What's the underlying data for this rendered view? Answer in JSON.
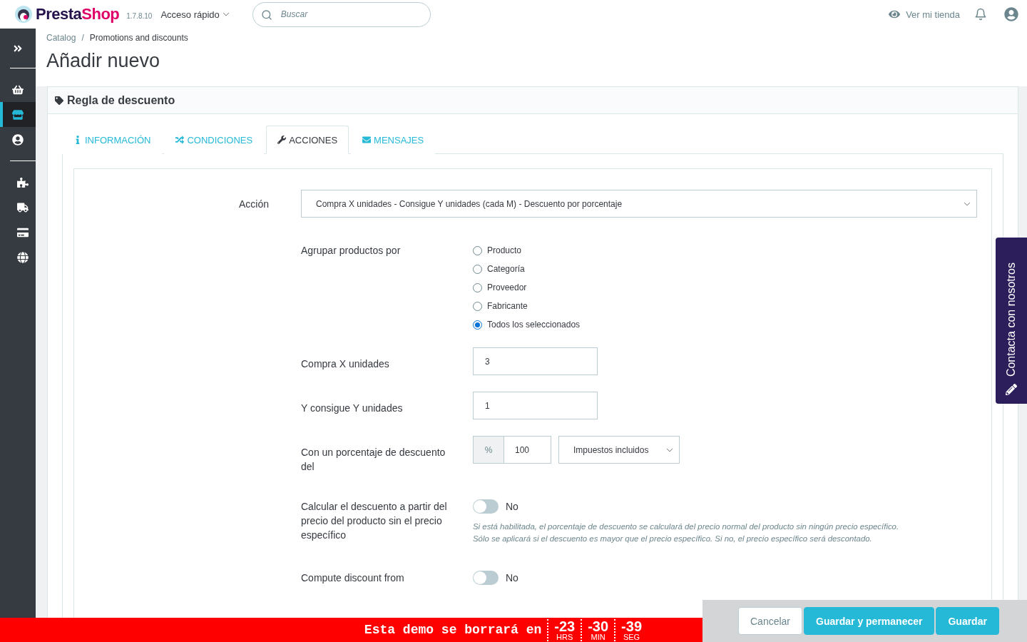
{
  "header": {
    "brand_left": "Presta",
    "brand_right": "Shop",
    "version": "1.7.8.10",
    "quick_access": "Acceso rápido",
    "search": {
      "placeholder": "Buscar"
    },
    "view_store": "Ver mi tienda"
  },
  "sidebar": {
    "groups": [
      [
        {
          "selected": false
        },
        {
          "selected": true
        },
        {
          "selected": false
        }
      ],
      [
        {
          "selected": false
        },
        {
          "selected": false
        },
        {
          "selected": false
        },
        {
          "selected": false
        }
      ]
    ]
  },
  "breadcrumb": {
    "separator": "/",
    "items": [
      "Catalog",
      "Promotions and discounts"
    ]
  },
  "page_title": "Añadir nuevo",
  "panel": {
    "title": "Regla de descuento",
    "tabs": [
      {
        "label": "INFORMACIÓN",
        "selected": false
      },
      {
        "label": "CONDICIONES",
        "selected": false
      },
      {
        "label": "ACCIONES",
        "selected": true
      },
      {
        "label": "MENSAJES",
        "selected": false
      }
    ],
    "action": {
      "label": "Acción",
      "value": "Compra X unidades - Consigue Y unidades (cada M) - Descuento por porcentaje"
    },
    "rows": [
      {
        "kind": "radios",
        "label": "Agrupar productos por",
        "options": [
          {
            "label": "Producto",
            "selected": false
          },
          {
            "label": "Categoría",
            "selected": false
          },
          {
            "label": "Proveedor",
            "selected": false
          },
          {
            "label": "Fabricante",
            "selected": false
          },
          {
            "label": "Todos los seleccionados",
            "selected": true
          }
        ]
      },
      {
        "kind": "input",
        "label": "Compra X unidades",
        "value": "3"
      },
      {
        "kind": "input",
        "label": "Y consigue Y unidades",
        "value": "1"
      },
      {
        "kind": "percent",
        "label": "Con un porcentaje de descuento del",
        "addon": "%",
        "value": "100",
        "select": "Impuestos incluidos"
      },
      {
        "kind": "toggle",
        "label": "Calcular el descuento a partir del precio del producto sin el precio específico",
        "on": false,
        "state": "No",
        "help": [
          "Si está habilitada, el porcentaje de descuento se calculará del precio normal del producto sin ningún precio específico.",
          "Sólo se aplicará si el descuento es mayor que el precio específico. Si no, el precio específico será descontado."
        ]
      },
      {
        "kind": "toggle",
        "label": "Compute discount from",
        "on": false,
        "state": "No"
      }
    ]
  },
  "demo_banner": {
    "text": "Esta demo se borrará en",
    "units": [
      {
        "value": "-23",
        "unit": "HRS"
      },
      {
        "value": "-30",
        "unit": "MIN"
      },
      {
        "value": "-39",
        "unit": "SEG"
      }
    ]
  },
  "footer_buttons": [
    "Cancelar",
    "Guardar y permanecer",
    "Guardar"
  ],
  "contact_tab": "Contacta con nosotros"
}
